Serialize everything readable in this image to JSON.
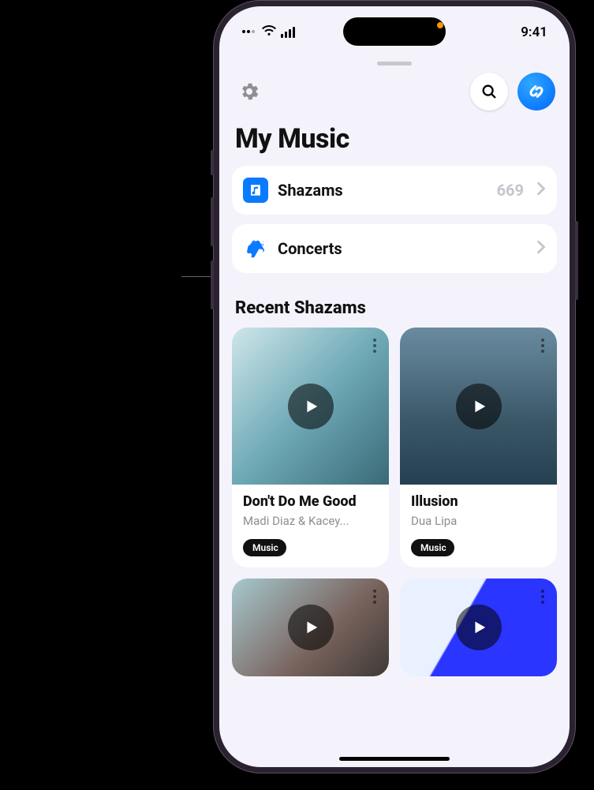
{
  "status": {
    "time": "9:41"
  },
  "page": {
    "title": "My Music"
  },
  "menu": {
    "shazams": {
      "label": "Shazams",
      "count": "669"
    },
    "concerts": {
      "label": "Concerts"
    }
  },
  "recent": {
    "title": "Recent Shazams",
    "tracks": [
      {
        "title": "Don't Do Me Good",
        "artist": "Madi Diaz & Kacey...",
        "badge": "Music"
      },
      {
        "title": "Illusion",
        "artist": "Dua Lipa",
        "badge": "Music"
      }
    ]
  }
}
